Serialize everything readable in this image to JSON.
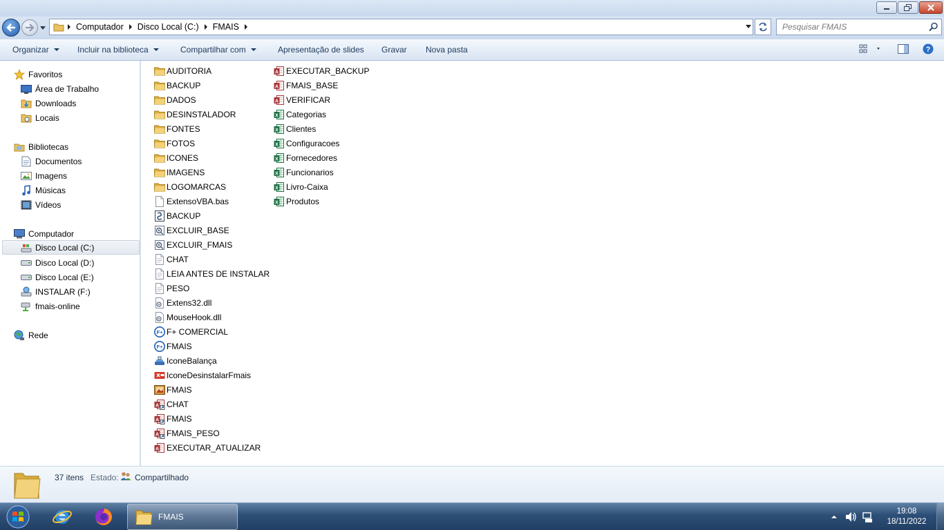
{
  "address": {
    "crumbs": [
      "Computador",
      "Disco Local (C:)",
      "FMAIS"
    ]
  },
  "search": {
    "placeholder": "Pesquisar FMAIS"
  },
  "toolbar": {
    "organize": "Organizar",
    "include": "Incluir na biblioteca",
    "share": "Compartilhar com",
    "slideshow": "Apresentação de slides",
    "burn": "Gravar",
    "newfolder": "Nova pasta"
  },
  "nav": {
    "favorites": "Favoritos",
    "desktop": "Área de Trabalho",
    "downloads": "Downloads",
    "places": "Locais",
    "libraries": "Bibliotecas",
    "documents": "Documentos",
    "images": "Imagens",
    "music": "Músicas",
    "videos": "Vídeos",
    "computer": "Computador",
    "drive_c": "Disco Local (C:)",
    "drive_d": "Disco Local (D:)",
    "drive_e": "Disco Local (E:)",
    "drive_f": "INSTALAR (F:)",
    "network_drive": "fmais-online",
    "network": "Rede"
  },
  "files": {
    "col1": [
      {
        "name": "AUDITORIA",
        "icon": "folder"
      },
      {
        "name": "BACKUP",
        "icon": "folder"
      },
      {
        "name": "DADOS",
        "icon": "folder"
      },
      {
        "name": "DESINSTALADOR",
        "icon": "folder"
      },
      {
        "name": "FONTES",
        "icon": "folder"
      },
      {
        "name": "FOTOS",
        "icon": "folder"
      },
      {
        "name": "ICONES",
        "icon": "folder"
      },
      {
        "name": "IMAGENS",
        "icon": "folder"
      },
      {
        "name": "LOGOMARCAS",
        "icon": "folder"
      },
      {
        "name": "ExtensoVBA.bas",
        "icon": "file"
      },
      {
        "name": "BACKUP",
        "icon": "script"
      },
      {
        "name": "EXCLUIR_BASE",
        "icon": "batch"
      },
      {
        "name": "EXCLUIR_FMAIS",
        "icon": "batch"
      },
      {
        "name": "CHAT",
        "icon": "text"
      },
      {
        "name": "LEIA ANTES DE INSTALAR",
        "icon": "text"
      },
      {
        "name": "PESO",
        "icon": "text"
      },
      {
        "name": "Extens32.dll",
        "icon": "dll"
      },
      {
        "name": "MouseHook.dll",
        "icon": "dll"
      },
      {
        "name": "F+ COMERCIAL",
        "icon": "app"
      },
      {
        "name": "FMAIS",
        "icon": "app"
      },
      {
        "name": "IconeBalança",
        "icon": "scale"
      },
      {
        "name": "IconeDesinstalarFmais",
        "icon": "uninstall"
      },
      {
        "name": "FMAIS",
        "icon": "image"
      },
      {
        "name": "CHAT",
        "icon": "access-shortcut"
      },
      {
        "name": "FMAIS",
        "icon": "access-shortcut"
      },
      {
        "name": "FMAIS_PESO",
        "icon": "access-shortcut"
      },
      {
        "name": "EXECUTAR_ATUALIZAR",
        "icon": "access"
      }
    ],
    "col2": [
      {
        "name": "EXECUTAR_BACKUP",
        "icon": "access"
      },
      {
        "name": "FMAIS_BASE",
        "icon": "access"
      },
      {
        "name": "VERIFICAR",
        "icon": "access"
      },
      {
        "name": "Categorias",
        "icon": "excel"
      },
      {
        "name": "Clientes",
        "icon": "excel"
      },
      {
        "name": "Configuracoes",
        "icon": "excel"
      },
      {
        "name": "Fornecedores",
        "icon": "excel"
      },
      {
        "name": "Funcionarios",
        "icon": "excel"
      },
      {
        "name": "Livro-Caixa",
        "icon": "excel"
      },
      {
        "name": "Produtos",
        "icon": "excel"
      }
    ]
  },
  "status": {
    "count": "37 itens",
    "state_label": "Estado:",
    "state_value": "Compartilhado"
  },
  "taskbar": {
    "active_window": "FMAIS",
    "time": "19:08",
    "date": "18/11/2022"
  }
}
